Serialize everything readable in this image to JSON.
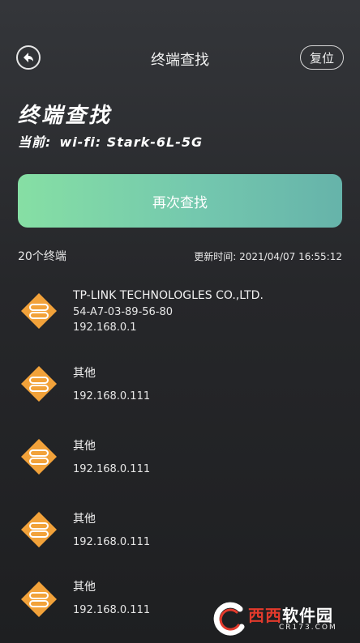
{
  "header": {
    "title": "终端查找",
    "reset_label": "复位"
  },
  "heading": {
    "title": "终端查找",
    "current_label": "当前:",
    "wifi_label": "wi-fi: Stark-6L-5G"
  },
  "actions": {
    "search_again_label": "再次查找"
  },
  "summary": {
    "count_label": "20个终端",
    "update_time": "更新时间: 2021/04/07 16:55:12"
  },
  "devices": [
    {
      "name": "TP-LINK TECHNOLOGLES CO.,LTD.",
      "mac": "54-A7-03-89-56-80",
      "ip": "192.168.0.1"
    },
    {
      "name": "其他",
      "ip": "192.168.0.111"
    },
    {
      "name": "其他",
      "ip": "192.168.0.111"
    },
    {
      "name": "其他",
      "ip": "192.168.0.111"
    },
    {
      "name": "其他",
      "ip": "192.168.0.111"
    }
  ],
  "watermark": {
    "brand_red": "西西",
    "brand_white": "软件园",
    "domain": "CR173.COM"
  },
  "colors": {
    "accent_start": "#86dfa4",
    "accent_end": "#66b3aa",
    "device_icon": "#f2a23a",
    "background": "#2a2b2e"
  },
  "icons": {
    "back": "back-arrow-icon",
    "device": "device-icon"
  }
}
